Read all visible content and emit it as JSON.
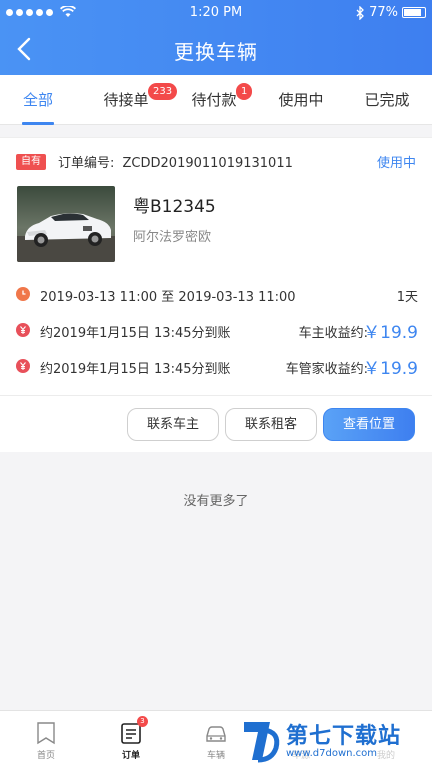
{
  "status_bar": {
    "carrier": "",
    "time": "1:20 PM",
    "battery": "77%"
  },
  "header": {
    "title": "更换车辆"
  },
  "tabs": [
    {
      "label": "全部",
      "active": true
    },
    {
      "label": "待接单",
      "badge": "233"
    },
    {
      "label": "待付款",
      "badge": "1"
    },
    {
      "label": "使用中"
    },
    {
      "label": "已完成"
    }
  ],
  "order": {
    "own_tag": "自有",
    "order_no_label": "订单编号:",
    "order_no": "ZCDD2019011019131011",
    "status": "使用中",
    "plate": "粤B12345",
    "model": "阿尔法罗密欧",
    "period": "2019-03-13 11:00 至 2019-03-13 11:00",
    "duration": "1天",
    "settlements": [
      {
        "text": "约2019年1月15日 13:45分到账",
        "label": "车主收益约:",
        "amount": "￥19.9"
      },
      {
        "text": "约2019年1月15日 13:45分到账",
        "label": "车管家收益约:",
        "amount": "￥19.9"
      }
    ],
    "buttons": {
      "contact_owner": "联系车主",
      "contact_renter": "联系租客",
      "view_location": "查看位置"
    }
  },
  "footer_note": "没有更多了",
  "tabbar": [
    {
      "label": "首页"
    },
    {
      "label": "订单",
      "badge": "3",
      "active": true
    },
    {
      "label": "车辆"
    },
    {
      "label": "车源"
    },
    {
      "label": "我的"
    }
  ],
  "watermark": {
    "text": "第七下载站",
    "url": "www.d7down.com"
  },
  "colors": {
    "primary": "#3e86f0",
    "badge": "#f34a4a",
    "time_icon": "#f0774a",
    "money_icon": "#e8505a"
  }
}
